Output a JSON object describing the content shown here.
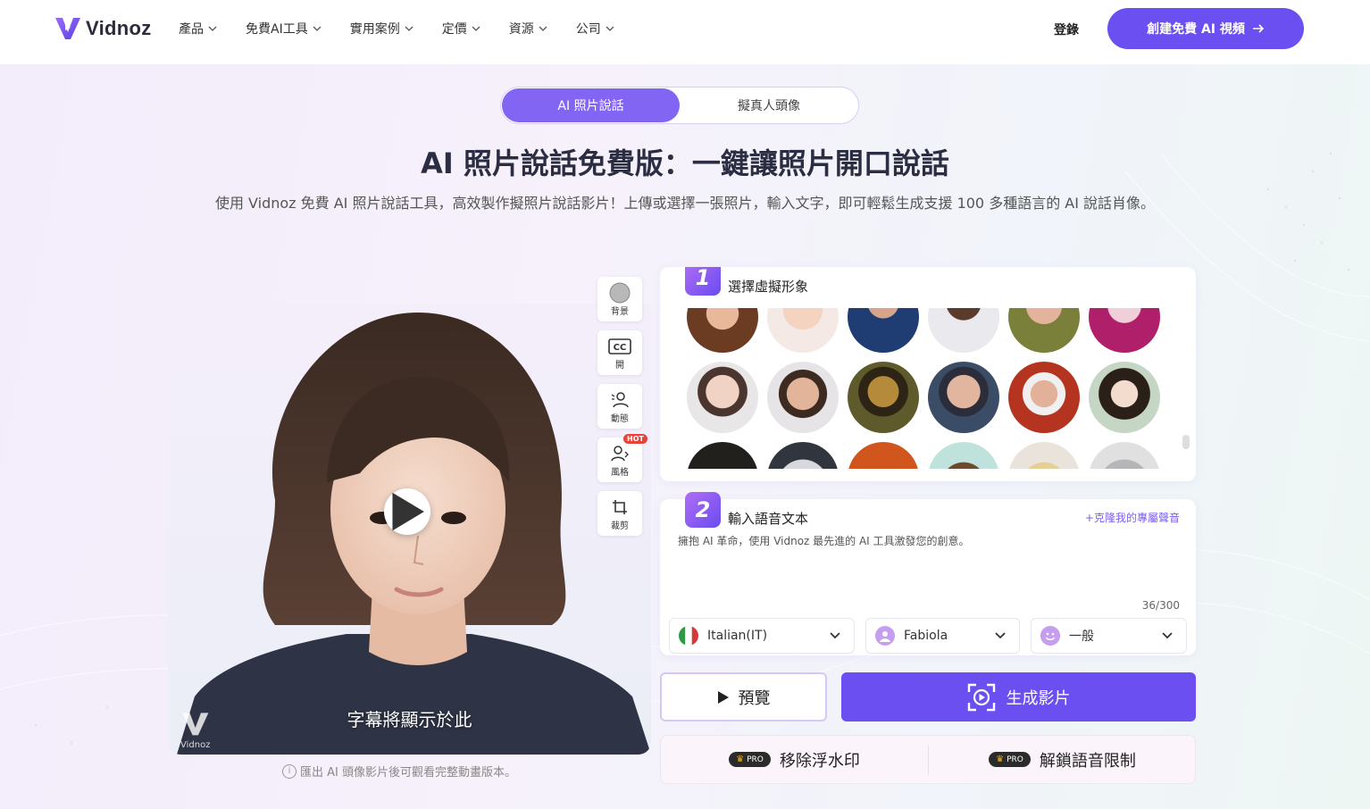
{
  "nav": {
    "logo_text": "Vidnoz",
    "menu": [
      "產品",
      "免費AI工具",
      "實用案例",
      "定價",
      "資源",
      "公司"
    ],
    "login": "登錄",
    "cta": "創建免費 AI 視頻"
  },
  "hero": {
    "tab_active": "AI 照片說話",
    "tab_inactive": "擬真人頭像",
    "title": "AI 照片說話免費版：一鍵讓照片開口說話",
    "subtitle": "使用 Vidnoz 免費 AI 照片說話工具，高效製作擬照片說話影片！上傳或選擇一張照片，輸入文字，即可輕鬆生成支援 100 多種語言的 AI 說話肖像。"
  },
  "preview": {
    "caption": "字幕將顯示於此",
    "watermark": "Vidnoz",
    "note": "匯出 AI 頭像影片後可觀看完整動畫版本。"
  },
  "tools": [
    {
      "label": "背景",
      "icon": "background-circle-icon"
    },
    {
      "label": "開",
      "icon": "cc-icon"
    },
    {
      "label": "動態",
      "icon": "motion-person-icon"
    },
    {
      "label": "風格",
      "icon": "style-person-icon",
      "badge": "HOT"
    },
    {
      "label": "裁剪",
      "icon": "crop-icon"
    }
  ],
  "step1": {
    "number": "1",
    "title": "選擇虛擬形象"
  },
  "step2": {
    "number": "2",
    "title": "輸入語音文本",
    "clone_link": "克隆我的專屬聲音",
    "text": "擁抱 AI 革命，使用 Vidnoz 最先進的 AI 工具激發您的創意。",
    "counter": "36/300",
    "language": "Italian(IT)",
    "voice": "Fabiola",
    "emotion": "一般"
  },
  "buttons": {
    "preview": "預覽",
    "generate": "生成影片",
    "remove_watermark": "移除浮水印",
    "unlock_voice": "解鎖語音限制",
    "pro_badge": "PRO"
  },
  "colors": {
    "accent": "#6c4ff0",
    "accent_light": "#8266f3",
    "hot": "#e8423a"
  }
}
